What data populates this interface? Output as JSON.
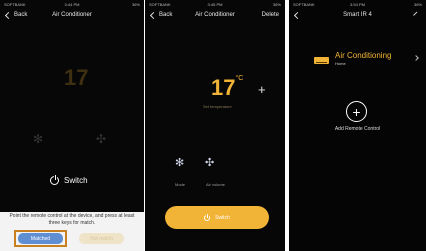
{
  "screen1": {
    "status": {
      "carrier": "SOFTBANK",
      "time": "3:44 PM",
      "battery": "36%"
    },
    "nav": {
      "back_label": "Back",
      "title": "Air Conditioner"
    },
    "temperature": "17",
    "switch_label": "Switch",
    "hint": "Point the remote control at the device, and press at least three keys for match.",
    "matched_label": "Matched",
    "not_matched_label": "Not match"
  },
  "screen2": {
    "status": {
      "carrier": "SOFTBANK",
      "time": "3:45 PM",
      "battery": "36%"
    },
    "nav": {
      "back_label": "Back",
      "title": "Air Conditioner",
      "delete_label": "Delete"
    },
    "temperature": "17",
    "temperature_unit": "°C",
    "temp_subtitle": "Set temperature",
    "plus_label": "+",
    "mode_label": "Mode",
    "fan_label": "Air volume",
    "switch_label": "Switch"
  },
  "screen3": {
    "status": {
      "carrier": "SOFTBANK",
      "time": "3:54 PM",
      "battery": "36%"
    },
    "nav": {
      "title": "Smart IR 4"
    },
    "device_name": "Air Conditioning",
    "device_room": "Home",
    "add_label": "Add Remote Control"
  },
  "colors": {
    "accent": "#f2b437",
    "matched": "#5f8ed3",
    "highlight": "#c9801e"
  },
  "icons": [
    "back-chevron-icon",
    "snowflake-icon",
    "fan-icon",
    "power-icon",
    "ac-icon",
    "plus-icon",
    "edit-icon"
  ]
}
